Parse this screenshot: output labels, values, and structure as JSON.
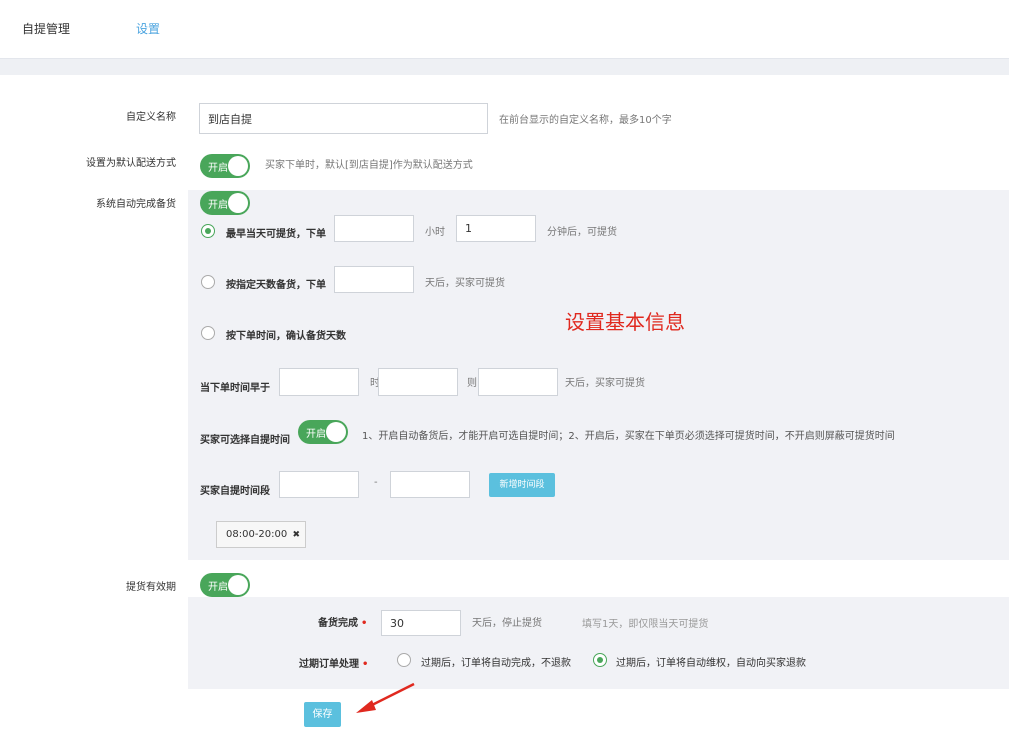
{
  "tabs": {
    "main": "自提管理",
    "settings": "设置"
  },
  "form": {
    "custom_name": {
      "label": "自定义名称",
      "value": "到店自提",
      "hint": "在前台显示的自定义名称，最多10个字"
    },
    "default_delivery": {
      "label": "设置为默认配送方式",
      "toggle": "开启",
      "hint": "买家下单时，默认[到店自提]作为默认配送方式"
    },
    "auto_stock": {
      "label": "系统自动完成备货",
      "toggle": "开启",
      "option1": {
        "label": "最早当天可提货，下单",
        "hours_value": "",
        "hours_unit": "小时",
        "minutes_value": "1",
        "minutes_suffix": "分钟后，可提货"
      },
      "option2": {
        "label": "按指定天数备货，下单",
        "days_value": "",
        "suffix": "天后，买家可提货"
      },
      "option3": {
        "label": "按下单时间，确认备货天数"
      },
      "order_time": {
        "label": "当下单时间早于",
        "hour_value": "",
        "hour_unit": "时",
        "minute_value": "",
        "minute_unit": "则",
        "days_value": "",
        "suffix": "天后，买家可提货"
      },
      "buyer_select": {
        "label": "买家可选择自提时间",
        "toggle": "开启",
        "hint": "1、开启自动备货后，才能开启可选自提时间；2、开启后，买家在下单页必须选择可提货时间，不开启则屏蔽可提货时间"
      },
      "time_range": {
        "label": "买家自提时间段",
        "start_value": "",
        "separator": "-",
        "end_value": "",
        "add_button": "新增时间段"
      },
      "time_tag": {
        "text": "08:00-20:00",
        "close": "✖"
      }
    },
    "validity": {
      "label": "提货有效期",
      "toggle": "开启",
      "stock_done": {
        "label": "备货完成",
        "required": "•",
        "value": "30",
        "suffix": "天后，停止提货",
        "hint": "填写1天，即仅限当天可提货"
      },
      "expired": {
        "label": "过期订单处理",
        "required": "•",
        "option1": "过期后，订单将自动完成，不退款",
        "option2": "过期后，订单将自动维权，自动向买家退款"
      }
    },
    "save_button": "保存"
  },
  "annotation": "设置基本信息"
}
